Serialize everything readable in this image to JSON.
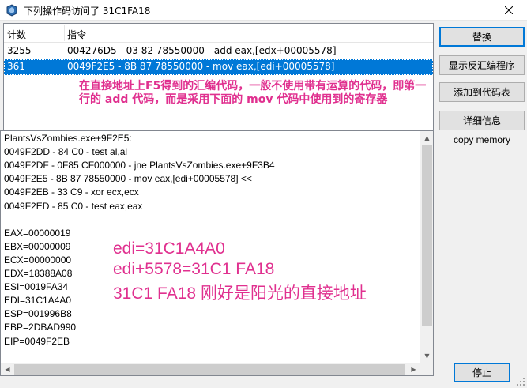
{
  "window": {
    "title": "下列操作码访问了 31C1FA18",
    "icon": "cheat-engine-icon"
  },
  "list": {
    "headers": [
      "计数",
      "指令"
    ],
    "rows": [
      {
        "count": "3255",
        "instruction": "004276D5 - 03 82 78550000  - add eax,[edx+00005578]"
      },
      {
        "count": "361",
        "instruction": "0049F2E5 - 8B 87 78550000  - mov eax,[edi+00005578]"
      }
    ],
    "selected_row": 1
  },
  "annotation_top": "在直接地址上F5得到的汇编代码，一般不使用带有运算的代码，即第一行的 add 代码，而是采用下面的 mov 代码中使用到的寄存器",
  "memory": {
    "lines": [
      "PlantsVsZombies.exe+9F2E5:",
      "0049F2DD - 84 C0  - test al,al",
      "0049F2DF - 0F85 CF000000 - jne PlantsVsZombies.exe+9F3B4",
      "0049F2E5 - 8B 87 78550000  - mov eax,[edi+00005578] <<",
      "0049F2EB - 33 C9  - xor ecx,ecx",
      "0049F2ED - 85 C0  - test eax,eax",
      "",
      "EAX=00000019",
      "EBX=00000009",
      "ECX=00000000",
      "EDX=18388A08",
      "ESI=0019FA34",
      "EDI=31C1A4A0",
      "ESP=001996B8",
      "EBP=2DBAD990",
      "EIP=0049F2EB"
    ]
  },
  "annotation_bottom": [
    "edi=31C1A4A0",
    "edi+5578=31C1 FA18",
    "31C1 FA18 刚好是阳光的直接地址"
  ],
  "buttons": {
    "replace": "替换",
    "show_disassembler": "显示反汇编程序",
    "add_to_codelist": "添加到代码表",
    "more_info": "详细信息",
    "copy_memory": "copy memory",
    "stop": "停止"
  },
  "colors": {
    "selection": "#0078d7",
    "annotation": "#e0308f"
  }
}
